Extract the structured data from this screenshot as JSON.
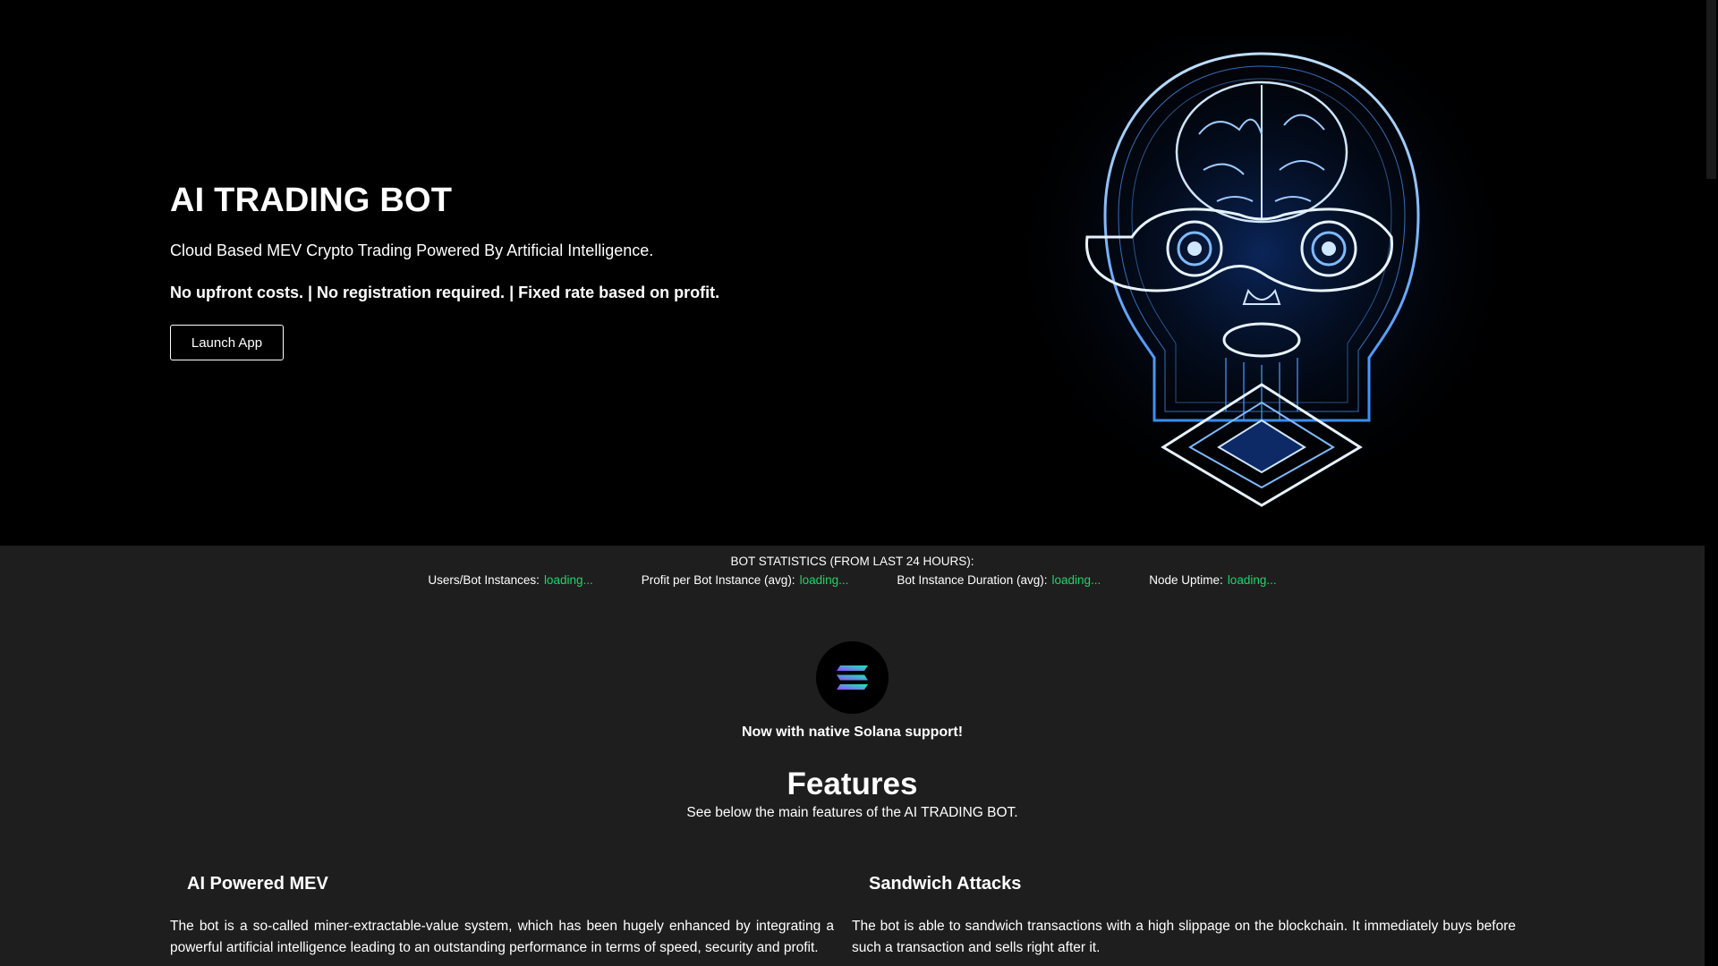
{
  "hero": {
    "title": "AI TRADING BOT",
    "subtitle": "Cloud Based MEV Crypto Trading Powered By Artificial Intelligence.",
    "tagline": "No upfront costs. | No registration required. | Fixed rate based on profit.",
    "launch_label": "Launch App"
  },
  "stats": {
    "title": "BOT STATISTICS (FROM LAST 24 HOURS):",
    "items": [
      {
        "label": "Users/Bot Instances:",
        "value": "loading..."
      },
      {
        "label": "Profit per Bot Instance (avg):",
        "value": "loading..."
      },
      {
        "label": "Bot Instance Duration (avg):",
        "value": "loading..."
      },
      {
        "label": "Node Uptime:",
        "value": "loading..."
      }
    ],
    "value_color": "#22d36a"
  },
  "solana": {
    "text": "Now with native Solana support!"
  },
  "features": {
    "title": "Features",
    "subtitle": "See below the main features of the AI TRADING BOT.",
    "items": [
      {
        "title": "AI Powered MEV",
        "body": "The bot is a so-called miner-extractable-value system, which has been hugely enhanced by integrating a powerful artificial intelligence leading to an outstanding performance in terms of speed, security and profit."
      },
      {
        "title": "Sandwich Attacks",
        "body": "The bot is able to sandwich transactions with a high slippage on the blockchain. It immediately buys before such a transaction and sells right after it."
      }
    ]
  }
}
